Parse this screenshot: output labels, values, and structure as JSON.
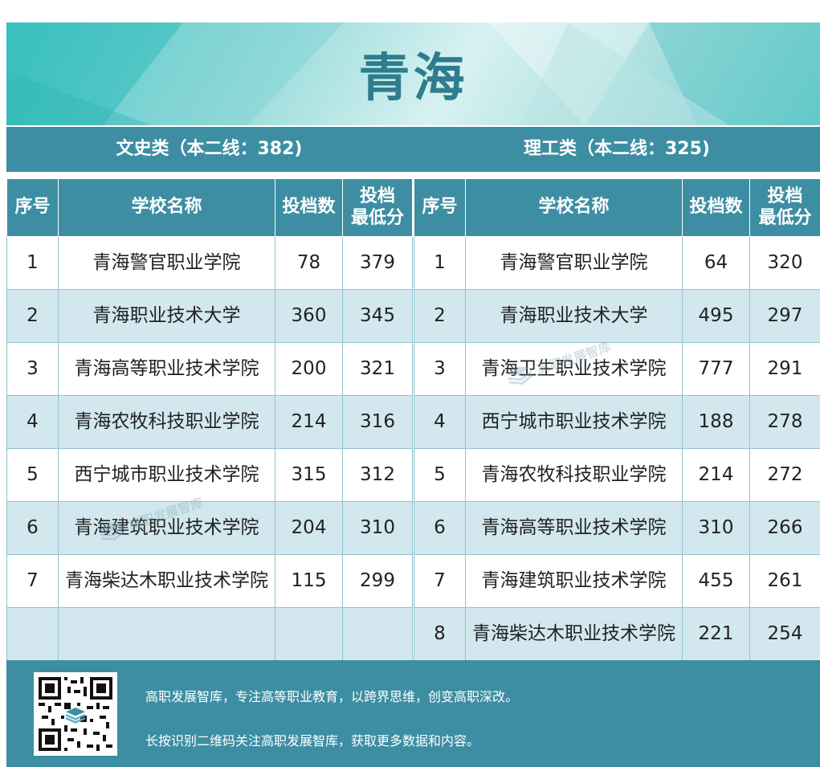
{
  "banner": {
    "title": "青海"
  },
  "categories": {
    "left": "文史类（本二线：382)",
    "right": "理工类（本二线：325)"
  },
  "table_headers": {
    "index": "序号",
    "school": "学校名称",
    "count": "投档数",
    "min_score_line1": "投档",
    "min_score_line2": "最低分"
  },
  "liberal_arts": [
    {
      "no": "1",
      "school": "青海警官职业学院",
      "count": "78",
      "min": "379"
    },
    {
      "no": "2",
      "school": "青海职业技术大学",
      "count": "360",
      "min": "345"
    },
    {
      "no": "3",
      "school": "青海高等职业技术学院",
      "count": "200",
      "min": "321"
    },
    {
      "no": "4",
      "school": "青海农牧科技职业学院",
      "count": "214",
      "min": "316"
    },
    {
      "no": "5",
      "school": "西宁城市职业技术学院",
      "count": "315",
      "min": "312"
    },
    {
      "no": "6",
      "school": "青海建筑职业技术学院",
      "count": "204",
      "min": "310"
    },
    {
      "no": "7",
      "school": "青海柴达木职业技术学院",
      "count": "115",
      "min": "299"
    },
    {
      "no": "",
      "school": "",
      "count": "",
      "min": ""
    }
  ],
  "science": [
    {
      "no": "1",
      "school": "青海警官职业学院",
      "count": "64",
      "min": "320"
    },
    {
      "no": "2",
      "school": "青海职业技术大学",
      "count": "495",
      "min": "297"
    },
    {
      "no": "3",
      "school": "青海卫生职业技术学院",
      "count": "777",
      "min": "291"
    },
    {
      "no": "4",
      "school": "西宁城市职业技术学院",
      "count": "188",
      "min": "278"
    },
    {
      "no": "5",
      "school": "青海农牧科技职业学院",
      "count": "214",
      "min": "272"
    },
    {
      "no": "6",
      "school": "青海高等职业技术学院",
      "count": "310",
      "min": "266"
    },
    {
      "no": "7",
      "school": "青海建筑职业技术学院",
      "count": "455",
      "min": "261"
    },
    {
      "no": "8",
      "school": "青海柴达木职业技术学院",
      "count": "221",
      "min": "254"
    }
  ],
  "footer": {
    "line1": "高职发展智库，专注高等职业教育，以跨界思维，创变高职深改。",
    "line2": "长按识别二维码关注高职发展智库，获取更多数据和内容。",
    "qr_icon": "qr-code-icon"
  },
  "watermark": {
    "text": "高职发展智库",
    "url": "www.gzfzk.com"
  },
  "colors": {
    "primary": "#3d8ea3",
    "alt_row": "#d2e8ee",
    "banner_title": "#2e7d8e"
  }
}
